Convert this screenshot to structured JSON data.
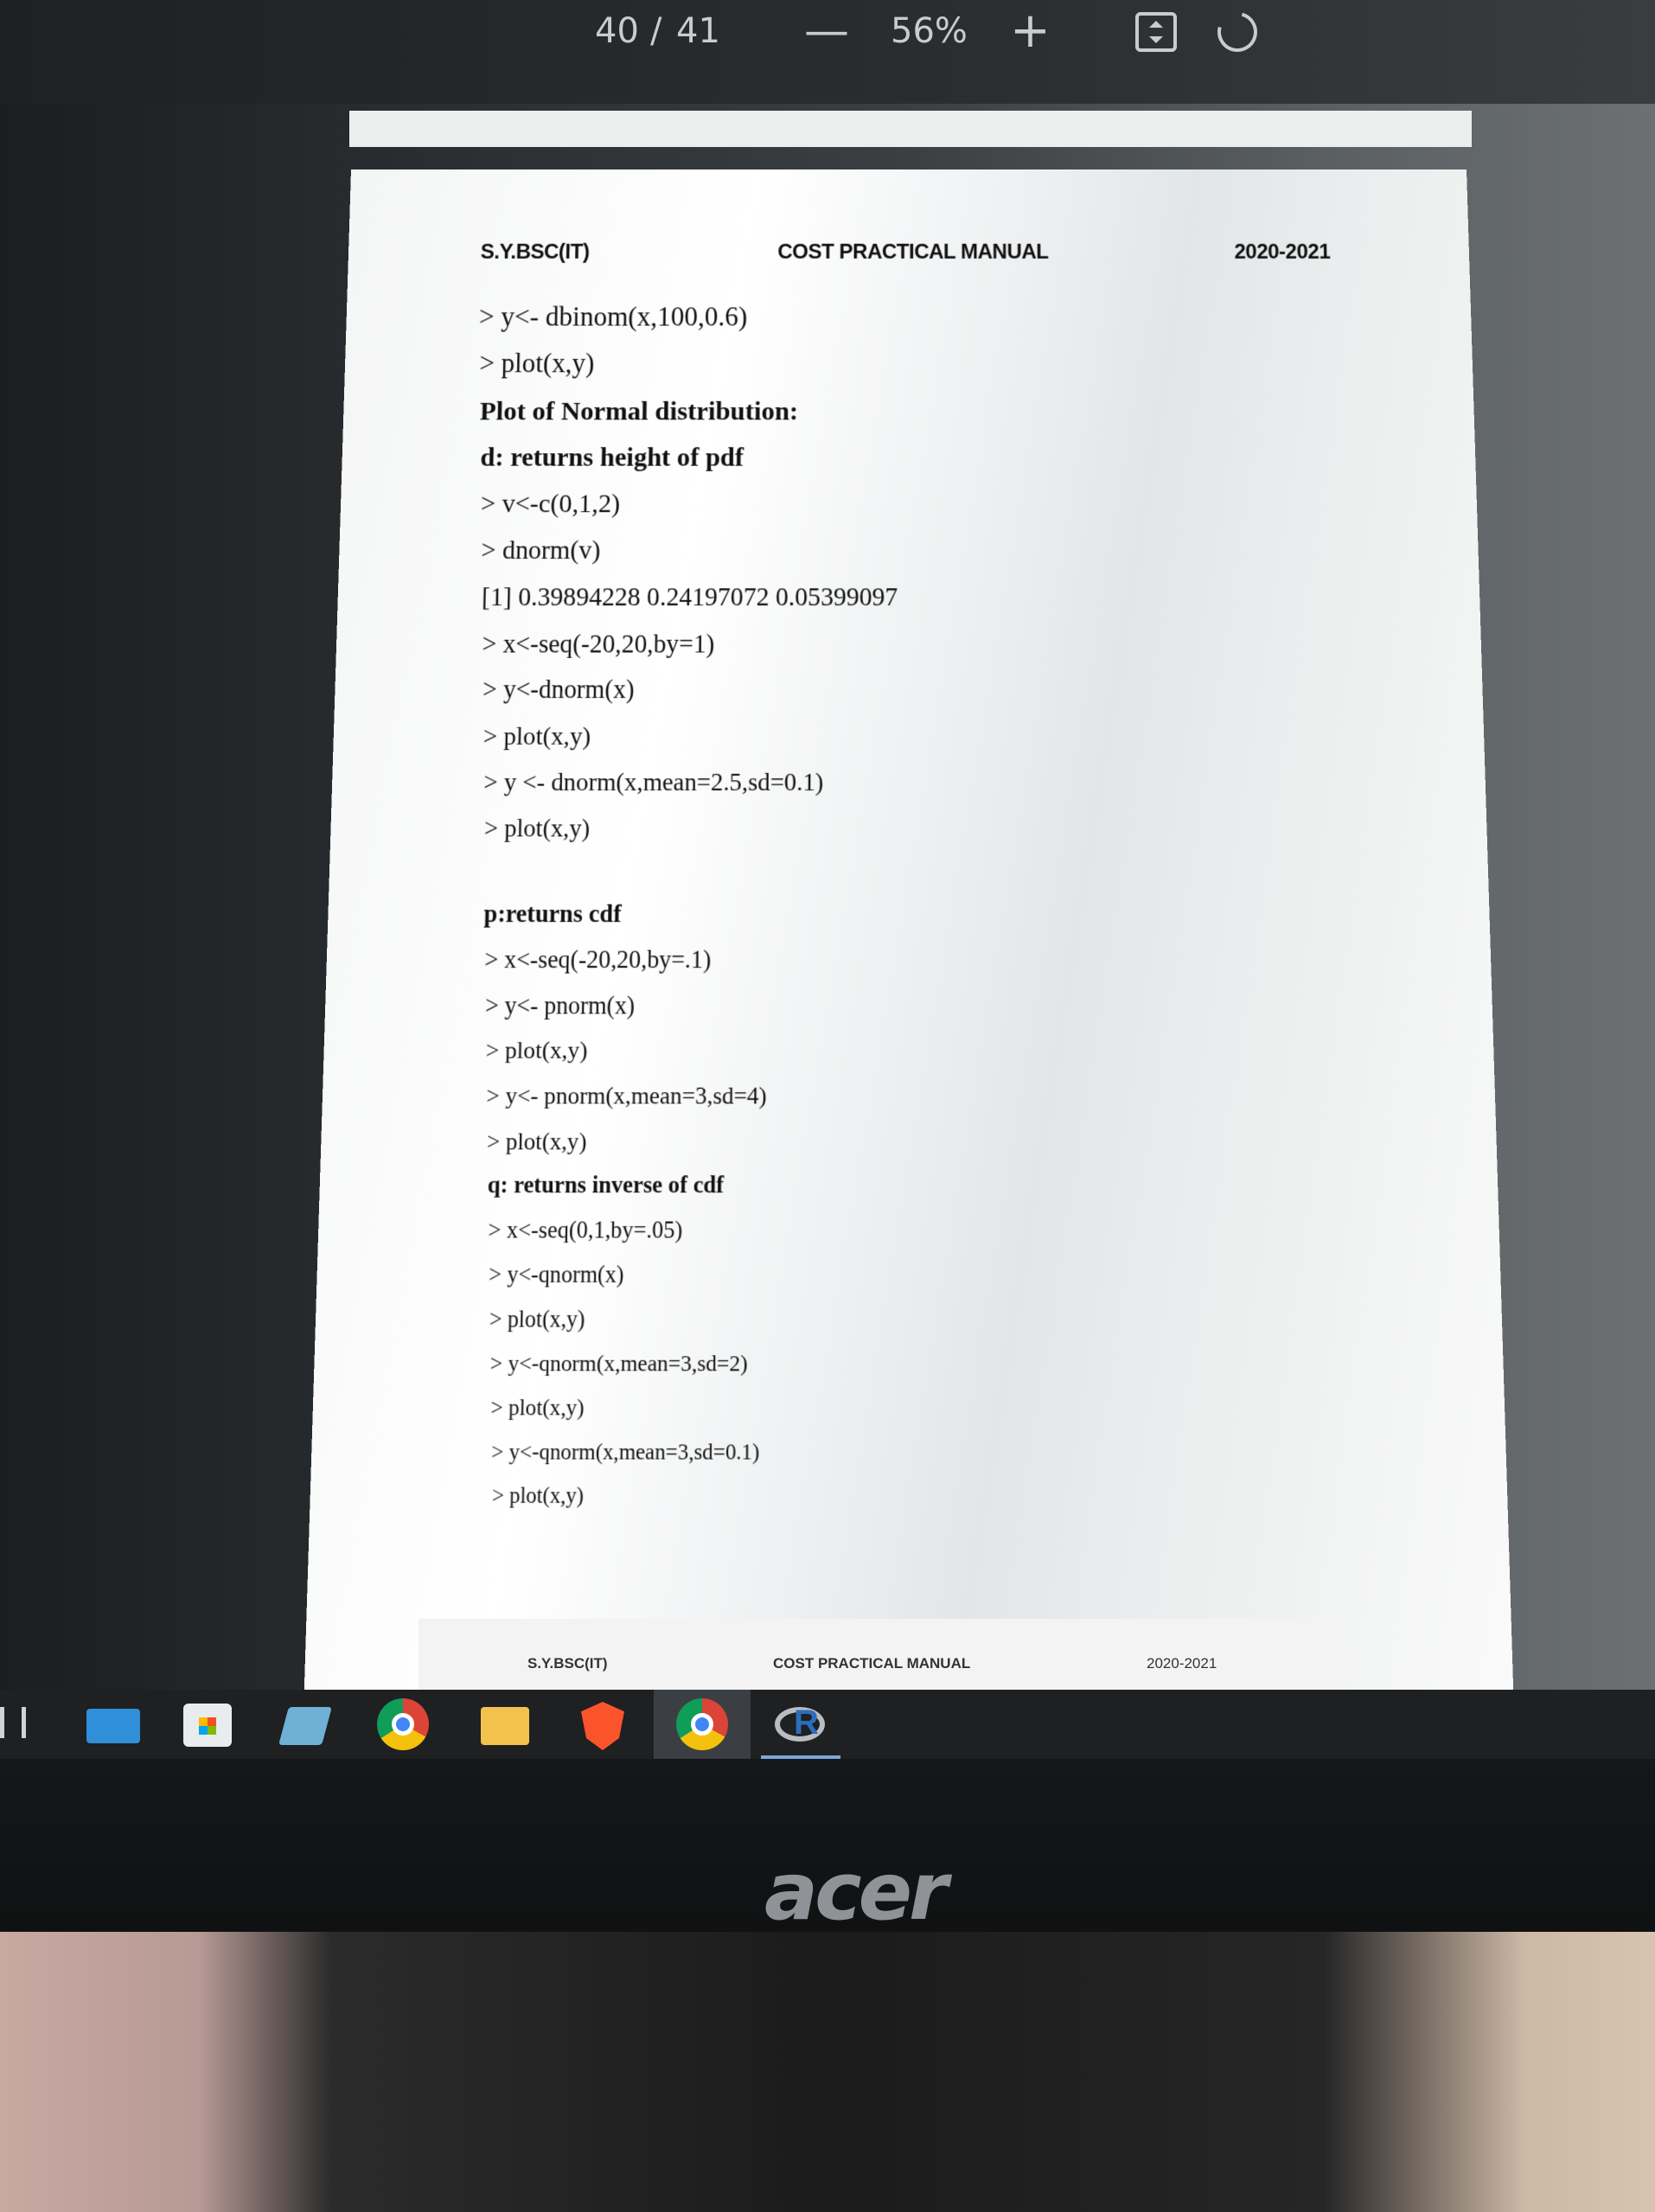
{
  "toolbar": {
    "page_current": "40",
    "page_separator": "/",
    "page_total": "41",
    "zoom_out_label": "—",
    "zoom_level": "56%",
    "zoom_in_label": "+"
  },
  "document": {
    "header": {
      "left": "S.Y.BSC(IT)",
      "center": "COST PRACTICAL MANUAL",
      "right": "2020-2021"
    },
    "lines": [
      {
        "text": "> y<- dbinom(x,100,0.6)",
        "bold": false
      },
      {
        "text": "> plot(x,y)",
        "bold": false
      },
      {
        "text": "Plot of Normal distribution:",
        "bold": true
      },
      {
        "text": "d: returns height of pdf",
        "bold": true
      },
      {
        "text": "> v<-c(0,1,2)",
        "bold": false
      },
      {
        "text": "> dnorm(v)",
        "bold": false
      },
      {
        "text": "[1] 0.39894228 0.24197072 0.05399097",
        "bold": false
      },
      {
        "text": "> x<-seq(-20,20,by=1)",
        "bold": false
      },
      {
        "text": "> y<-dnorm(x)",
        "bold": false
      },
      {
        "text": "> plot(x,y)",
        "bold": false
      },
      {
        "text": "> y <- dnorm(x,mean=2.5,sd=0.1)",
        "bold": false
      },
      {
        "text": "> plot(x,y)",
        "bold": false
      },
      {
        "text": "p:returns cdf",
        "bold": true
      },
      {
        "text": "> x<-seq(-20,20,by=.1)",
        "bold": false
      },
      {
        "text": "> y<- pnorm(x)",
        "bold": false
      },
      {
        "text": "> plot(x,y)",
        "bold": false
      },
      {
        "text": "> y<- pnorm(x,mean=3,sd=4)",
        "bold": false
      },
      {
        "text": "> plot(x,y)",
        "bold": false
      },
      {
        "text": "q: returns inverse of cdf",
        "bold": true
      },
      {
        "text": "> x<-seq(0,1,by=.05)",
        "bold": false
      },
      {
        "text": "> y<-qnorm(x)",
        "bold": false
      },
      {
        "text": "> plot(x,y)",
        "bold": false
      },
      {
        "text": "> y<-qnorm(x,mean=3,sd=2)",
        "bold": false
      },
      {
        "text": "> plot(x,y)",
        "bold": false
      },
      {
        "text": "> y<-qnorm(x,mean=3,sd=0.1)",
        "bold": false
      },
      {
        "text": "> plot(x,y)",
        "bold": false
      }
    ],
    "next_page_header": {
      "left": "S.Y.BSC(IT)",
      "center": "COST PRACTICAL MANUAL",
      "right": "2020-2021"
    }
  },
  "taskbar": {
    "icons": [
      "task-view-icon",
      "mail-icon",
      "store-icon",
      "photos-icon",
      "chrome-icon",
      "file-explorer-icon",
      "brave-icon",
      "chrome-icon",
      "r-icon"
    ]
  },
  "monitor": {
    "brand": "acer"
  }
}
